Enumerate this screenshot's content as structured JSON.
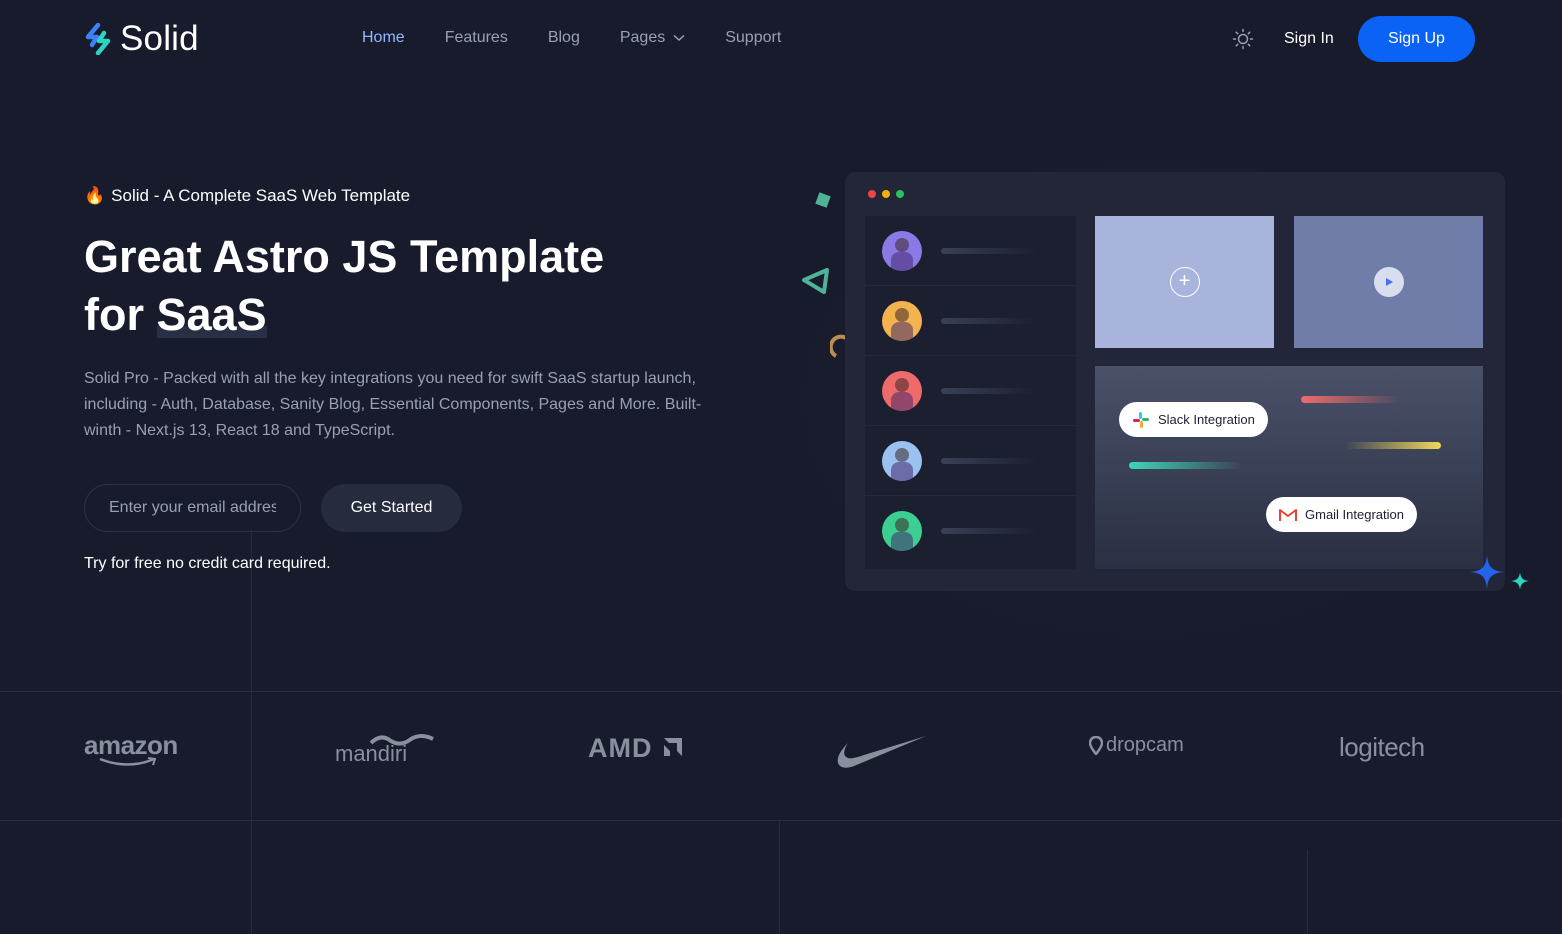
{
  "header": {
    "logo_text": "Solid",
    "nav": [
      {
        "label": "Home",
        "active": true
      },
      {
        "label": "Features"
      },
      {
        "label": "Blog"
      },
      {
        "label": "Pages",
        "has_dropdown": true
      },
      {
        "label": "Support"
      }
    ],
    "theme_toggle_icon": "sun-icon",
    "sign_in": "Sign In",
    "sign_up": "Sign Up"
  },
  "hero": {
    "eyebrow_icon": "🔥",
    "eyebrow": "Solid - A Complete SaaS Web Template",
    "title_line1": "Great Astro JS Template",
    "title_prefix": "for ",
    "title_highlight": "SaaS",
    "description": "Solid Pro - Packed with all the key integrations you need for swift SaaS startup launch, including - Auth, Database, Sanity Blog, Essential Components, Pages and More. Built-winth - Next.js 13, React 18 and TypeScript.",
    "email_placeholder": "Enter your email address",
    "cta": "Get Started",
    "note": "Try for free no credit card required."
  },
  "illustration": {
    "integrations": [
      {
        "label": "Slack Integration",
        "icon": "slack-icon"
      },
      {
        "label": "Gmail Integration",
        "icon": "gmail-icon"
      }
    ]
  },
  "brands": [
    "amazon",
    "mandiri",
    "AMD",
    "nike",
    "dropcam",
    "logitech"
  ],
  "colors": {
    "background": "#171b2b",
    "accent": "#0b63f6",
    "nav_active": "#93b8ff",
    "muted_text": "#9aa0b0"
  }
}
